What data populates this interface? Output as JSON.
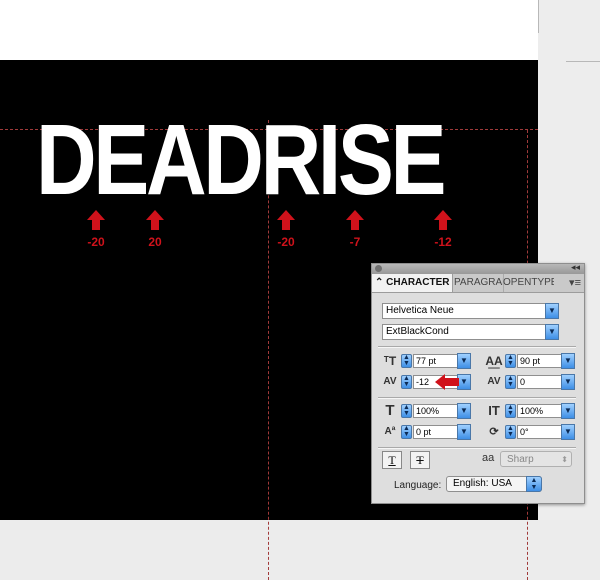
{
  "document": {
    "headline": "DEADRISE",
    "kerning_markers": [
      {
        "value": "-20"
      },
      {
        "value": "20"
      },
      {
        "value": "-20"
      },
      {
        "value": "-7"
      },
      {
        "value": "-12"
      }
    ],
    "marker_color": "#d0121b"
  },
  "character_panel": {
    "tabs": [
      {
        "label": "CHARACTER",
        "active": true
      },
      {
        "label": "PARAGRAPH",
        "active": false
      },
      {
        "label": "OPENTYPE",
        "active": false
      }
    ],
    "font_family": "Helvetica Neue",
    "font_style": "ExtBlackCond",
    "font_size": "77 pt",
    "leading": "90 pt",
    "kerning": "-12",
    "tracking": "0",
    "vertical_scale": "100%",
    "horizontal_scale": "100%",
    "baseline_shift": "0 pt",
    "rotation": "0°",
    "anti_alias": "Sharp",
    "anti_alias_icon": "aa",
    "language_label": "Language:",
    "language": "English: USA",
    "accent_color": "#3e8fe6"
  }
}
